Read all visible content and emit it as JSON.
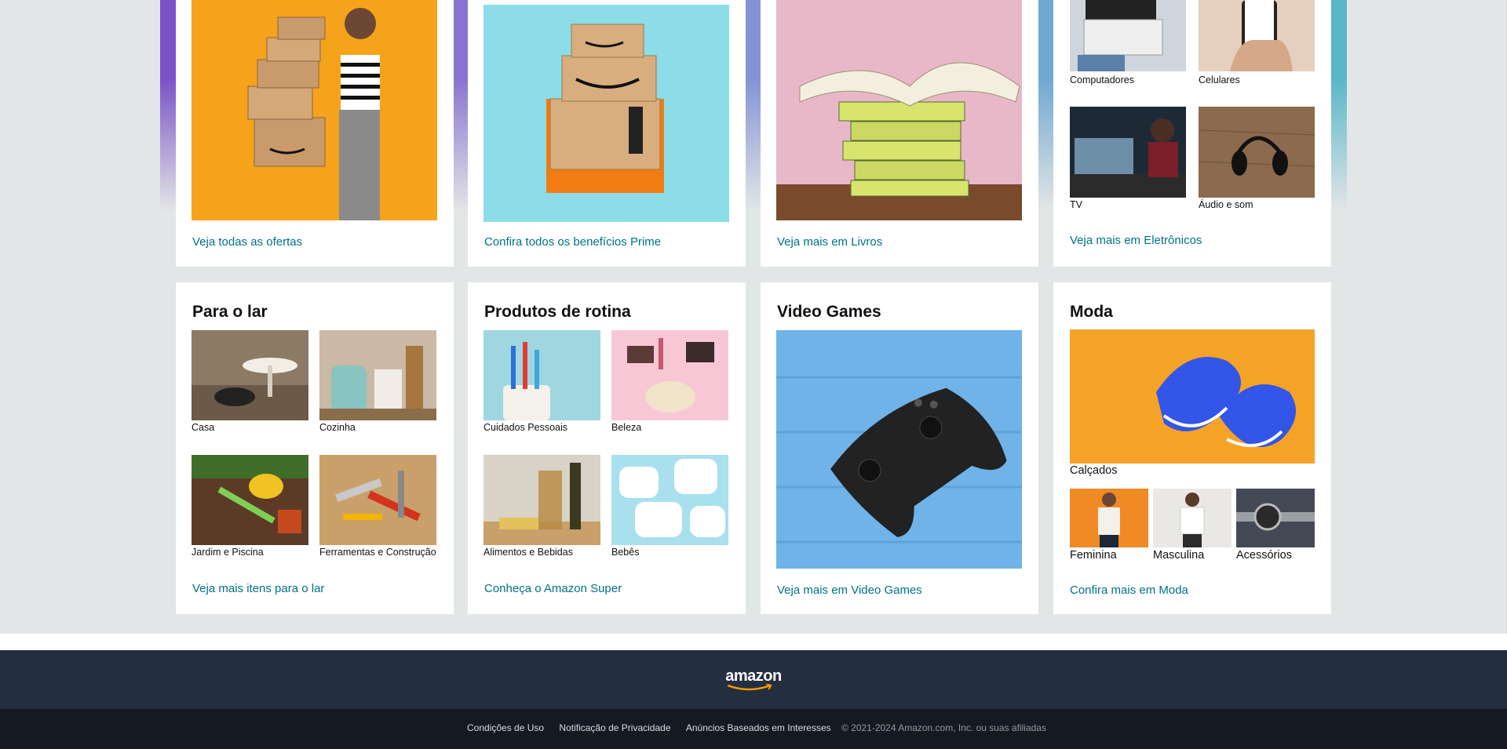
{
  "top_cards": [
    {
      "link": "Veja todas as ofertas"
    },
    {
      "link": "Confira todos os benefícios Prime"
    },
    {
      "link": "Veja mais em Livros"
    },
    {
      "link": "Veja mais em Eletrônicos",
      "items": [
        "Computadores",
        "Celulares",
        "TV",
        "Áudio e som"
      ]
    }
  ],
  "home": {
    "title": "Para o lar",
    "items": [
      "Casa",
      "Cozinha",
      "Jardim e Piscina",
      "Ferramentas e Construção"
    ],
    "link": "Veja mais itens para o lar"
  },
  "routine": {
    "title": "Produtos de rotina",
    "items": [
      "Cuidados Pessoais",
      "Beleza",
      "Alimentos e Bebidas",
      "Bebês"
    ],
    "link": "Conheça o Amazon Super"
  },
  "games": {
    "title": "Video Games",
    "link": "Veja mais em Video Games"
  },
  "fashion": {
    "title": "Moda",
    "main_item": "Calçados",
    "items": [
      "Feminina",
      "Masculina",
      "Acessórios"
    ],
    "link": "Confira mais em Moda"
  },
  "footer": {
    "logo": "amazon",
    "links": [
      "Condições de Uso",
      "Notificação de Privacidade",
      "Anúncios Baseados em Interesses"
    ],
    "copyright": "© 2021-2024 Amazon.com, Inc. ou suas afiliadas"
  },
  "colors": {
    "link": "#007185",
    "footer_top": "#232f3e",
    "footer_bottom": "#131a22",
    "page_bg": "#e3e6e6",
    "logo_smile": "#ff9900"
  }
}
